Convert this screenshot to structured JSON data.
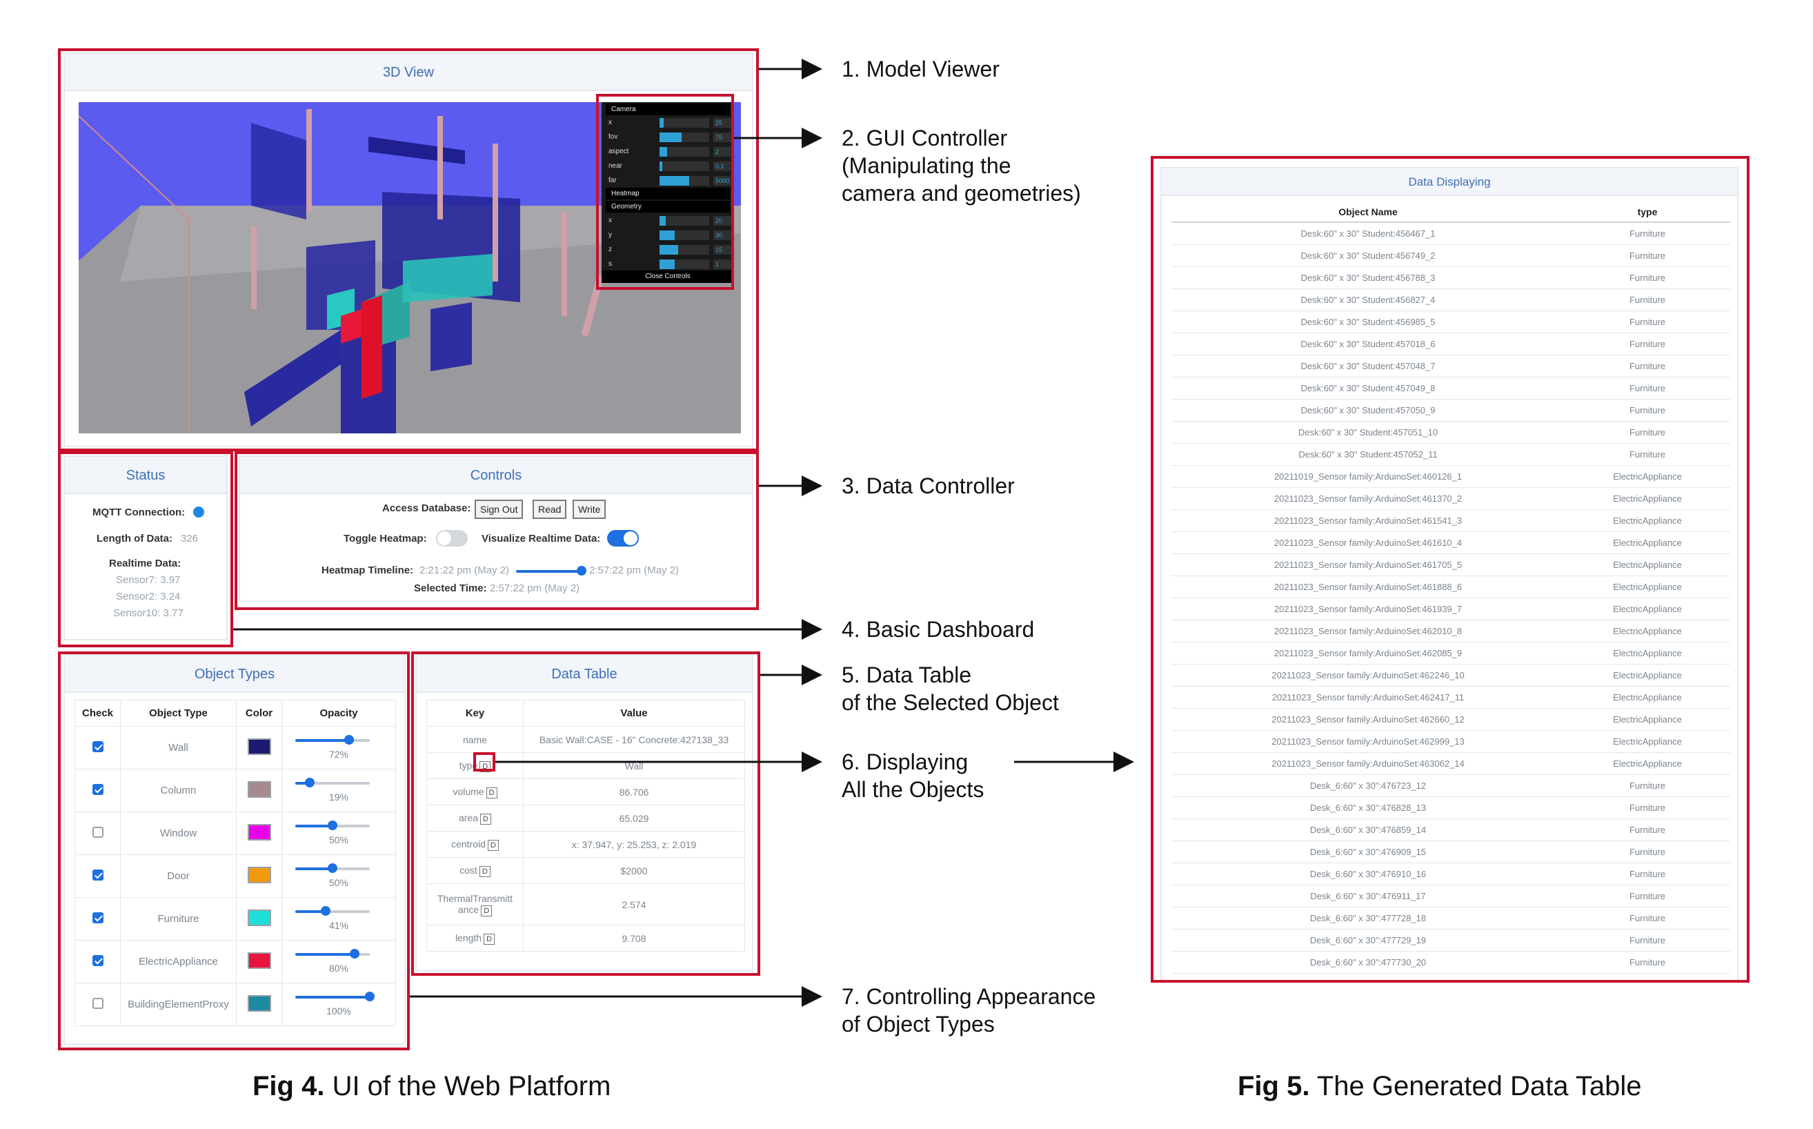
{
  "view3d": {
    "title": "3D View",
    "gui": {
      "sections": [
        "Camera",
        "Heatmap",
        "Geometry"
      ],
      "camera_rows": [
        {
          "name": "x",
          "value": "25",
          "level": 0.08
        },
        {
          "name": "fov",
          "value": "75",
          "level": 0.45
        },
        {
          "name": "aspect",
          "value": "2",
          "level": 0.15
        },
        {
          "name": "near",
          "value": "0.1",
          "level": 0.05
        },
        {
          "name": "far",
          "value": "5000",
          "level": 0.6
        }
      ],
      "geometry_rows": [
        {
          "name": "x",
          "value": "20",
          "level": 0.12
        },
        {
          "name": "y",
          "value": "30",
          "level": 0.3
        },
        {
          "name": "z",
          "value": "15",
          "level": 0.38
        },
        {
          "name": "s",
          "value": "1",
          "level": 0.3
        }
      ],
      "close_label": "Close Controls"
    }
  },
  "status": {
    "title": "Status",
    "mqtt_label": "MQTT Connection:",
    "length_label": "Length of Data:",
    "length_value": "326",
    "realtime_label": "Realtime Data:",
    "sensors": [
      "Sensor7: 3.97",
      "Sensor2: 3.24",
      "Sensor10: 3.77"
    ]
  },
  "controls": {
    "title": "Controls",
    "access_label": "Access Database:",
    "sign_out": "Sign Out",
    "read": "Read",
    "write": "Write",
    "toggle_heatmap_label": "Toggle Heatmap:",
    "visualize_label": "Visualize Realtime Data:",
    "timeline_label": "Heatmap Timeline:",
    "timeline_start": "2:21:22 pm (May 2)",
    "timeline_end": "2:57:22 pm (May 2)",
    "selected_label": "Selected Time:",
    "selected_value": "2:57:22 pm (May 2)"
  },
  "object_types": {
    "title": "Object Types",
    "headers": [
      "Check",
      "Object Type",
      "Color",
      "Opacity"
    ],
    "rows": [
      {
        "checked": true,
        "type": "Wall",
        "color": "#1b1a6e",
        "opacity": "72%",
        "level": 0.72
      },
      {
        "checked": true,
        "type": "Column",
        "color": "#a88a8e",
        "opacity": "19%",
        "level": 0.19
      },
      {
        "checked": false,
        "type": "Window",
        "color": "#e800e8",
        "opacity": "50%",
        "level": 0.5
      },
      {
        "checked": true,
        "type": "Door",
        "color": "#f39a0c",
        "opacity": "50%",
        "level": 0.5
      },
      {
        "checked": true,
        "type": "Furniture",
        "color": "#1ee0d8",
        "opacity": "41%",
        "level": 0.41
      },
      {
        "checked": true,
        "type": "ElectricAppliance",
        "color": "#e8143c",
        "opacity": "80%",
        "level": 0.8
      },
      {
        "checked": false,
        "type": "BuildingElementProxy",
        "color": "#1c8aa0",
        "opacity": "100%",
        "level": 1.0
      }
    ]
  },
  "data_table": {
    "title": "Data Table",
    "headers": [
      "Key",
      "Value"
    ],
    "button": "D",
    "rows": [
      {
        "key": "name",
        "value": "Basic Wall:CASE - 16\" Concrete:427138_33",
        "btn": false
      },
      {
        "key": "type",
        "value": "Wall",
        "btn": true
      },
      {
        "key": "volume",
        "value": "86.706",
        "btn": true
      },
      {
        "key": "area",
        "value": "65.029",
        "btn": true
      },
      {
        "key": "centroid",
        "value": "x: 37.947, y: 25.253, z: 2.019",
        "btn": true
      },
      {
        "key": "cost",
        "value": "$2000",
        "btn": true
      },
      {
        "key": "ThermalTransmitt ance",
        "value": "2.574",
        "btn": true
      },
      {
        "key": "length",
        "value": "9.708",
        "btn": true
      }
    ]
  },
  "annotations": {
    "a1": [
      "1. Model Viewer"
    ],
    "a2": [
      "2. GUI Controller",
      "(Manipulating the",
      "camera and geometries)"
    ],
    "a3": [
      "3. Data Controller"
    ],
    "a4": [
      "4. Basic Dashboard"
    ],
    "a5": [
      "5. Data Table",
      "of the Selected Object"
    ],
    "a6": [
      "6. Displaying",
      "All the Objects"
    ],
    "a7": [
      "7. Controlling Appearance",
      "of Object Types"
    ]
  },
  "captions": {
    "fig4_bold": "Fig 4.",
    "fig4_text": " UI of the Web Platform",
    "fig5_bold": "Fig 5.",
    "fig5_text": " The Generated Data Table"
  },
  "data_displaying": {
    "title": "Data Displaying",
    "headers": [
      "Object Name",
      "type"
    ],
    "rows": [
      [
        "Desk:60\" x 30\" Student:456467_1",
        "Furniture"
      ],
      [
        "Desk:60\" x 30\" Student:456749_2",
        "Furniture"
      ],
      [
        "Desk:60\" x 30\" Student:456788_3",
        "Furniture"
      ],
      [
        "Desk:60\" x 30\" Student:456827_4",
        "Furniture"
      ],
      [
        "Desk:60\" x 30\" Student:456985_5",
        "Furniture"
      ],
      [
        "Desk:60\" x 30\" Student:457018_6",
        "Furniture"
      ],
      [
        "Desk:60\" x 30\" Student:457048_7",
        "Furniture"
      ],
      [
        "Desk:60\" x 30\" Student:457049_8",
        "Furniture"
      ],
      [
        "Desk:60\" x 30\" Student:457050_9",
        "Furniture"
      ],
      [
        "Desk:60\" x 30\" Student:457051_10",
        "Furniture"
      ],
      [
        "Desk:60\" x 30\" Student:457052_11",
        "Furniture"
      ],
      [
        "20211019_Sensor family:ArduinoSet:460126_1",
        "ElectricAppliance"
      ],
      [
        "20211023_Sensor family:ArduinoSet:461370_2",
        "ElectricAppliance"
      ],
      [
        "20211023_Sensor family:ArduinoSet:461541_3",
        "ElectricAppliance"
      ],
      [
        "20211023_Sensor family:ArduinoSet:461610_4",
        "ElectricAppliance"
      ],
      [
        "20211023_Sensor family:ArduinoSet:461705_5",
        "ElectricAppliance"
      ],
      [
        "20211023_Sensor family:ArduinoSet:461888_6",
        "ElectricAppliance"
      ],
      [
        "20211023_Sensor family:ArduinoSet:461939_7",
        "ElectricAppliance"
      ],
      [
        "20211023_Sensor family:ArduinoSet:462010_8",
        "ElectricAppliance"
      ],
      [
        "20211023_Sensor family:ArduinoSet:462085_9",
        "ElectricAppliance"
      ],
      [
        "20211023_Sensor family:ArduinoSet:462246_10",
        "ElectricAppliance"
      ],
      [
        "20211023_Sensor family:ArduinoSet:462417_11",
        "ElectricAppliance"
      ],
      [
        "20211023_Sensor family:ArduinoSet:462660_12",
        "ElectricAppliance"
      ],
      [
        "20211023_Sensor family:ArduinoSet:462999_13",
        "ElectricAppliance"
      ],
      [
        "20211023_Sensor family:ArduinoSet:463062_14",
        "ElectricAppliance"
      ],
      [
        "Desk_6:60\" x 30\":476723_12",
        "Furniture"
      ],
      [
        "Desk_6:60\" x 30\":476828_13",
        "Furniture"
      ],
      [
        "Desk_6:60\" x 30\":476859_14",
        "Furniture"
      ],
      [
        "Desk_6:60\" x 30\":476909_15",
        "Furniture"
      ],
      [
        "Desk_6:60\" x 30\":476910_16",
        "Furniture"
      ],
      [
        "Desk_6:60\" x 30\":476911_17",
        "Furniture"
      ],
      [
        "Desk_6:60\" x 30\":477728_18",
        "Furniture"
      ],
      [
        "Desk_6:60\" x 30\":477729_19",
        "Furniture"
      ],
      [
        "Desk_6:60\" x 30\":477730_20",
        "Furniture"
      ]
    ]
  },
  "colors": {
    "highlight_red": "#c8102e",
    "panel_title_blue": "#3f6fb5",
    "viewport_sky": "#5b5bf0",
    "accent_blue": "#1e6fe0"
  }
}
